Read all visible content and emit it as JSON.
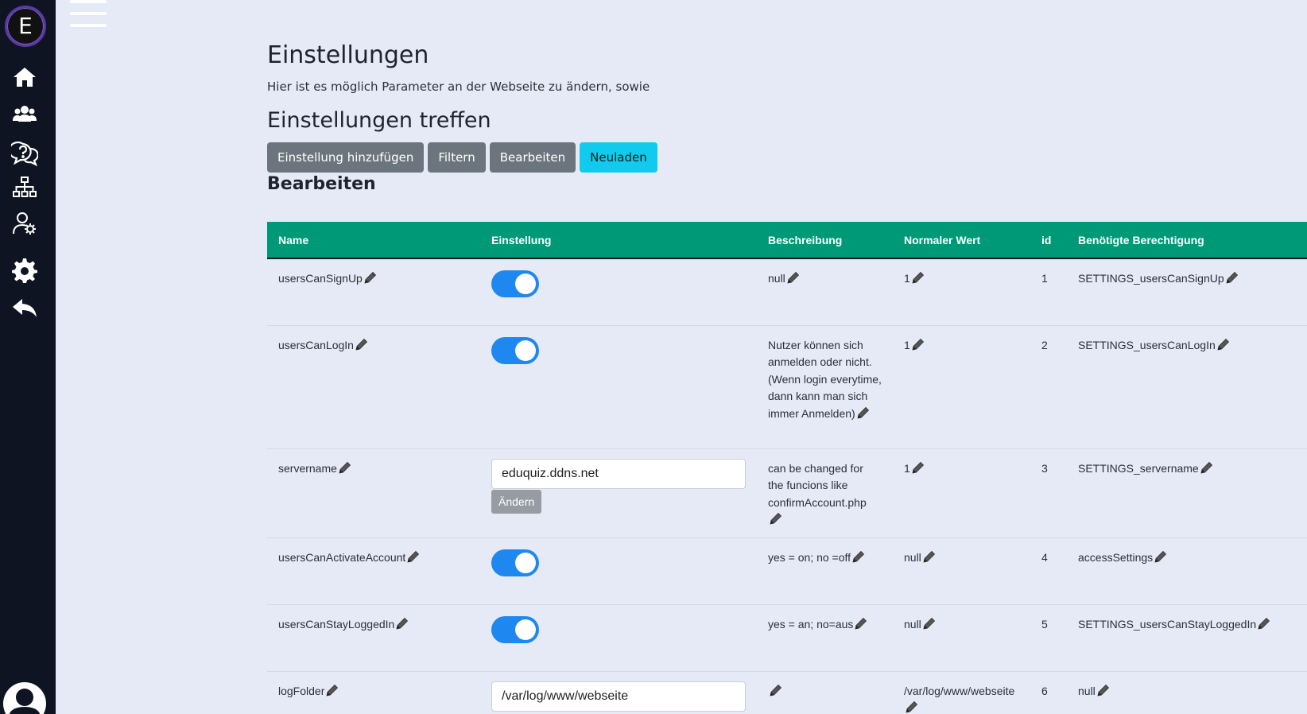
{
  "sidebar": {
    "logo_letter": "E",
    "icons": [
      "home-icon",
      "users-icon",
      "help-chat-icon",
      "sitemap-icon",
      "user-gear-icon",
      "settings-gear-icon",
      "back-arrow-icon",
      "user-avatar-icon"
    ]
  },
  "header": {
    "title": "Einstellungen",
    "subtitle": "Hier ist es möglich Parameter an der Webseite zu ändern, sowie",
    "section_title": "Einstellungen treffen",
    "buttons": {
      "add": "Einstellung hinzufügen",
      "filter": "Filtern",
      "edit": "Bearbeiten",
      "reload": "Neuladen"
    },
    "sub_title": "Bearbeiten"
  },
  "table": {
    "columns": [
      "Name",
      "Einstellung",
      "Beschreibung",
      "Normaler Wert",
      "id",
      "Benötigte Berechtigung"
    ],
    "rows": [
      {
        "name": "usersCanSignUp",
        "setting_type": "toggle",
        "setting_value": "on",
        "description": "null",
        "default": "1",
        "id": "1",
        "permission": "SETTINGS_usersCanSignUp"
      },
      {
        "name": "usersCanLogIn",
        "setting_type": "toggle",
        "setting_value": "on",
        "description": "Nutzer können sich anmelden oder nicht. (Wenn login everytime, dann kann man sich immer Anmelden)",
        "default": "1",
        "id": "2",
        "permission": "SETTINGS_usersCanLogIn"
      },
      {
        "name": "servername",
        "setting_type": "text",
        "setting_value": "eduquiz.ddns.net",
        "button": "Ändern",
        "description": "can be changed for the funcions like confirmAccount.php",
        "default": "1",
        "id": "3",
        "permission": "SETTINGS_servername"
      },
      {
        "name": "usersCanActivateAccount",
        "setting_type": "toggle",
        "setting_value": "on",
        "description": "yes = on; no =off",
        "default": "null",
        "id": "4",
        "permission": "accessSettings"
      },
      {
        "name": "usersCanStayLoggedIn",
        "setting_type": "toggle",
        "setting_value": "on",
        "description": "yes = an; no=aus",
        "default": "null",
        "id": "5",
        "permission": "SETTINGS_usersCanStayLoggedIn"
      },
      {
        "name": "logFolder",
        "setting_type": "text",
        "setting_value": "/var/log/www/webseite",
        "description": "",
        "default": "/var/log/www/webseite",
        "id": "6",
        "permission": "null"
      }
    ]
  },
  "colors": {
    "sidebar_bg": "#0f1422",
    "page_bg": "#e6eaf6",
    "table_header": "#009978",
    "toggle_on": "#1e88f0",
    "btn_secondary": "#6c757d",
    "btn_info": "#11cbee"
  }
}
